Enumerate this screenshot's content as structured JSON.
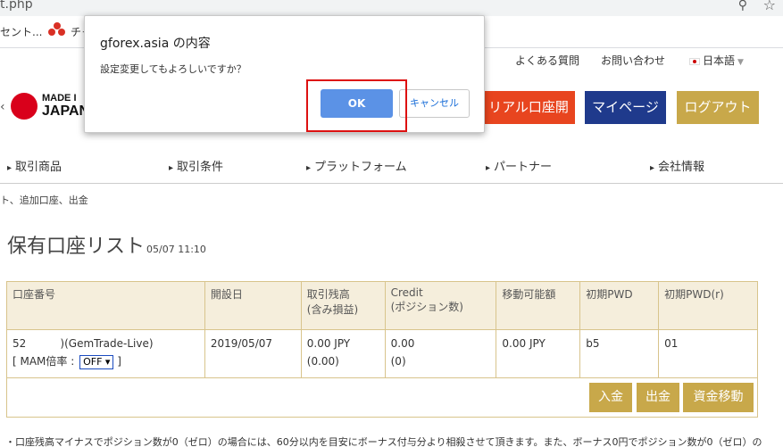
{
  "browser": {
    "url_fragment": "t.php",
    "zoom_icon": "zoom-icon",
    "star_icon": "bookmark-star-icon",
    "bookmarks": [
      "セント...",
      "チャ"
    ]
  },
  "header": {
    "util_links": [
      "よくある質問",
      "お問い合わせ",
      "日本語"
    ],
    "logo_line1": "MADE I",
    "logo_line2": "JAPAN",
    "buttons": {
      "real_account": "リアル口座開設",
      "mypage": "マイページ",
      "logout": "ログアウト"
    }
  },
  "nav": [
    "取引商品",
    "取引条件",
    "プラットフォーム",
    "パートナー",
    "会社情報"
  ],
  "breadcrumb": "ト、追加口座、出金",
  "page": {
    "title": "保有口座リスト",
    "timestamp": "05/07 11:10"
  },
  "table": {
    "headers": [
      [
        "口座番号"
      ],
      [
        "開設日"
      ],
      [
        "取引残高",
        "(含み損益)"
      ],
      [
        "Credit",
        "(ポジション数)"
      ],
      [
        "移動可能額"
      ],
      [
        "初期PWD"
      ],
      [
        "初期PWD(r)"
      ]
    ],
    "row": {
      "account": "52          )(GemTrade-Live)",
      "mam_label": "[ MAM倍率 :",
      "mam_value": "OFF ▾",
      "mam_close": "]",
      "open_date": "2019/05/07",
      "balance": "0.00 JPY",
      "pnl": "(0.00)",
      "credit": "0.00",
      "positions": "(0)",
      "movable": "0.00 JPY",
      "init_pwd": "b5",
      "init_pwd_r": "01"
    },
    "actions": {
      "deposit": "入金",
      "withdraw": "出金",
      "transfer": "資金移動"
    }
  },
  "footer_note": "・口座残高マイナスでポジション数が0（ゼロ）の場合には、60分以内を目安にボーナス付与分より相殺させて頂きます。また、ボーナス0円でポジション数が0（ゼロ）の",
  "dialog": {
    "title": "gforex.asia の内容",
    "message": "設定変更してもよろしいですか？",
    "ok": "OK",
    "cancel": "キャンセル"
  }
}
